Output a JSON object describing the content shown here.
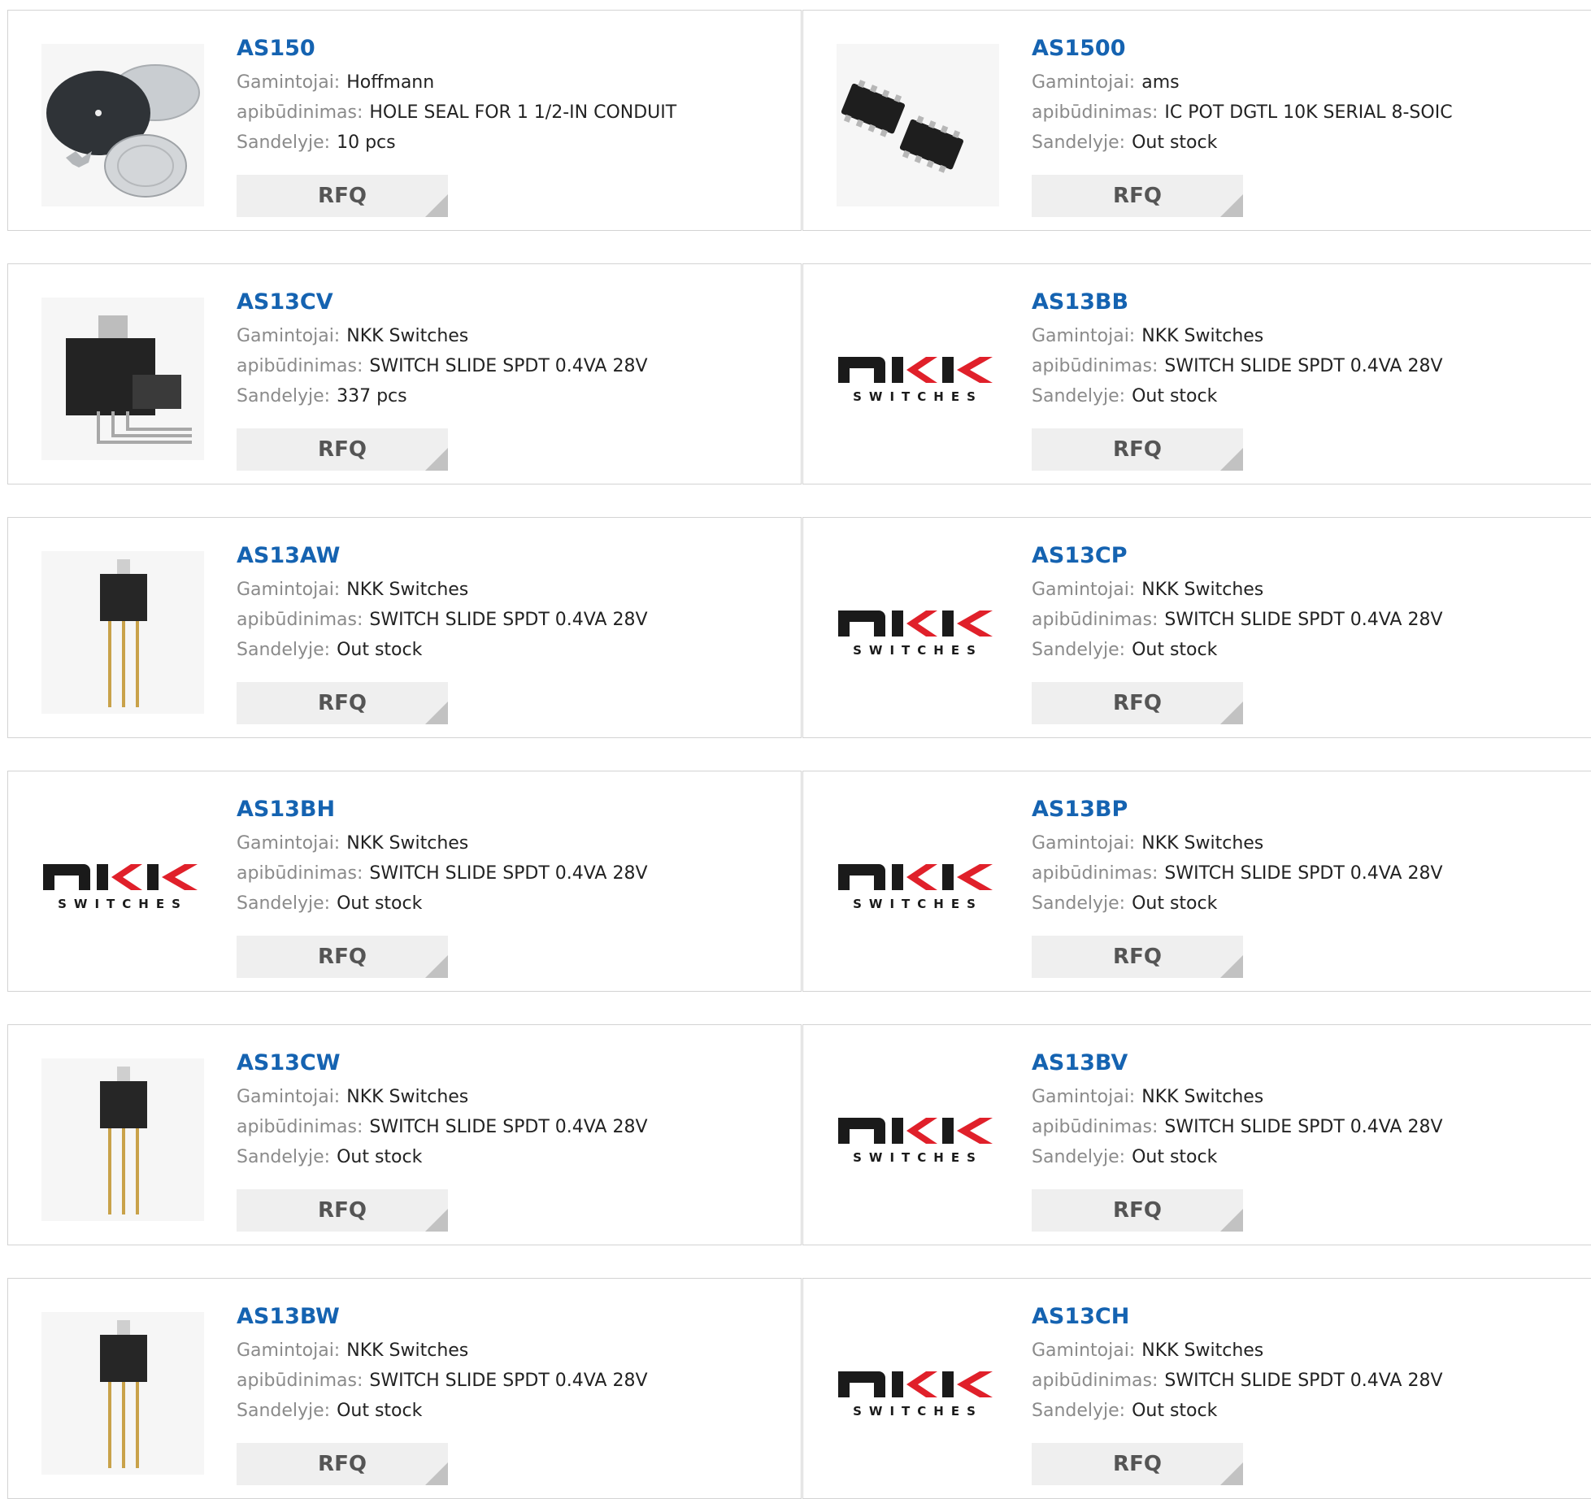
{
  "labels": {
    "manufacturer": "Gamintojai:",
    "description": "apibūdinimas:",
    "stock": "Sandelyje:",
    "rfq": "RFQ"
  },
  "products": [
    {
      "pn": "AS150",
      "manufacturer": "Hoffmann",
      "description": "HOLE SEAL FOR 1 1/2-IN CONDUIT",
      "stock": "10 pcs",
      "image": "hole-seal-photo"
    },
    {
      "pn": "AS1500",
      "manufacturer": "ams",
      "description": "IC POT DGTL 10K SERIAL 8-SOIC",
      "stock": "Out stock",
      "image": "soic8-chip-photo"
    },
    {
      "pn": "AS13CV",
      "manufacturer": "NKK Switches",
      "description": "SWITCH SLIDE SPDT 0.4VA 28V",
      "stock": "337 pcs",
      "image": "right-angle-switch-photo"
    },
    {
      "pn": "AS13BB",
      "manufacturer": "NKK Switches",
      "description": "SWITCH SLIDE SPDT 0.4VA 28V",
      "stock": "Out stock",
      "image": "nkk-logo",
      "logo_text": "SWITCHES"
    },
    {
      "pn": "AS13AW",
      "manufacturer": "NKK Switches",
      "description": "SWITCH SLIDE SPDT 0.4VA 28V",
      "stock": "Out stock",
      "image": "vertical-switch-photo"
    },
    {
      "pn": "AS13CP",
      "manufacturer": "NKK Switches",
      "description": "SWITCH SLIDE SPDT 0.4VA 28V",
      "stock": "Out stock",
      "image": "nkk-logo",
      "logo_text": "SWITCHES"
    },
    {
      "pn": "AS13BH",
      "manufacturer": "NKK Switches",
      "description": "SWITCH SLIDE SPDT 0.4VA 28V",
      "stock": "Out stock",
      "image": "nkk-logo",
      "logo_text": "SWITCHES"
    },
    {
      "pn": "AS13BP",
      "manufacturer": "NKK Switches",
      "description": "SWITCH SLIDE SPDT 0.4VA 28V",
      "stock": "Out stock",
      "image": "nkk-logo",
      "logo_text": "SWITCHES"
    },
    {
      "pn": "AS13CW",
      "manufacturer": "NKK Switches",
      "description": "SWITCH SLIDE SPDT 0.4VA 28V",
      "stock": "Out stock",
      "image": "vertical-switch-photo"
    },
    {
      "pn": "AS13BV",
      "manufacturer": "NKK Switches",
      "description": "SWITCH SLIDE SPDT 0.4VA 28V",
      "stock": "Out stock",
      "image": "nkk-logo",
      "logo_text": "SWITCHES"
    },
    {
      "pn": "AS13BW",
      "manufacturer": "NKK Switches",
      "description": "SWITCH SLIDE SPDT 0.4VA 28V",
      "stock": "Out stock",
      "image": "vertical-switch-photo"
    },
    {
      "pn": "AS13CH",
      "manufacturer": "NKK Switches",
      "description": "SWITCH SLIDE SPDT 0.4VA 28V",
      "stock": "Out stock",
      "image": "nkk-logo",
      "logo_text": "SWITCHES"
    }
  ],
  "colors": {
    "part_number": "#1563b1",
    "label": "#8a8a8a",
    "value": "#222222",
    "rfq_bg": "#efefef",
    "rfq_corner": "#c2c2c2",
    "nkk_black": "#1a1a1a",
    "nkk_red": "#e0202a"
  }
}
